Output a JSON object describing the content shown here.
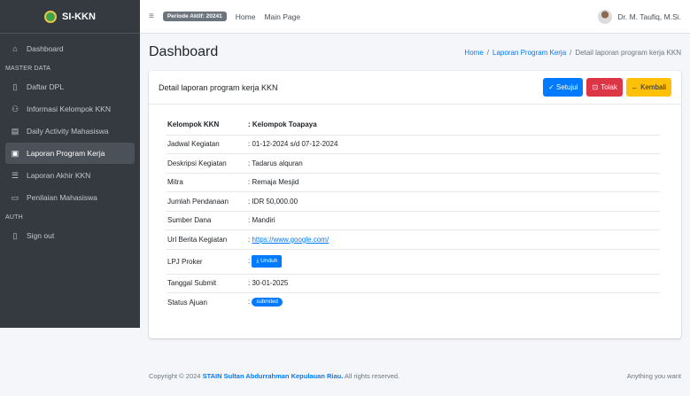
{
  "app": {
    "brand": "SI-KKN"
  },
  "sidebar": {
    "items": [
      {
        "label": "Dashboard",
        "icon": "home-icon",
        "glyph": "⌂"
      },
      {
        "label": "Daftar DPL",
        "icon": "document-icon",
        "glyph": "▯"
      },
      {
        "label": "Informasi Kelompok KKN",
        "icon": "users-icon",
        "glyph": "⚇"
      },
      {
        "label": "Daily Activity Mahasiswa",
        "icon": "calendar-icon",
        "glyph": "▤"
      },
      {
        "label": "Laporan Program Kerja",
        "icon": "file-icon",
        "glyph": "▣",
        "active": true
      },
      {
        "label": "Laporan Akhir KKN",
        "icon": "list-icon",
        "glyph": "☰"
      },
      {
        "label": "Penilaian Mahasiswa",
        "icon": "clipboard-icon",
        "glyph": "▭"
      },
      {
        "label": "Sign out",
        "icon": "logout-icon",
        "glyph": "▯"
      }
    ],
    "headers": {
      "master": "MASTER DATA",
      "auth": "AUTH"
    }
  },
  "topbar": {
    "periode": "Periode Aktif: 20241",
    "links": [
      "Home",
      "Main Page"
    ],
    "user": "Dr. M. Taufiq, M.Si."
  },
  "page": {
    "title": "Dashboard",
    "breadcrumb": [
      "Home",
      "Laporan Program Kerja",
      "Detail laporan program kerja KKN"
    ]
  },
  "card": {
    "title": "Detail laporan program kerja KKN",
    "buttons": {
      "approve": "✓ Setujui",
      "reject": "Tolak",
      "back": "← Kembali"
    }
  },
  "detail": {
    "rows": [
      {
        "label": "Kelompok KKN",
        "value": ": Kelompok Toapaya"
      },
      {
        "label": "Jadwal Kegiatan",
        "value": ": 01-12-2024 s/d 07-12-2024"
      },
      {
        "label": "Deskripsi Kegiatan",
        "value": ": Tadarus alquran"
      },
      {
        "label": "Mitra",
        "value": ": Remaja Mesjid"
      },
      {
        "label": "Jumlah Pendanaan",
        "value": ": IDR 50,000.00"
      },
      {
        "label": "Sumber Dana",
        "value": ": Mandiri"
      },
      {
        "label": "Url Berita Kegiatan",
        "value": "https://www.google.com/"
      },
      {
        "label": "LPJ Proker",
        "value": "Unduh"
      },
      {
        "label": "Tanggal Submit",
        "value": ": 30-01-2025"
      },
      {
        "label": "Status Ajuan",
        "value": "submited"
      }
    ]
  },
  "footer": {
    "prefix": "Copyright © 2024",
    "org": "STAIN Sultan Abdurrahman Kepulauan Riau.",
    "suffix": "All rights reserved.",
    "right": "Anything you want"
  },
  "colors": {
    "sidebar": "#343a40",
    "primary": "#007bff",
    "danger": "#dc3545",
    "warning": "#ffc107"
  }
}
